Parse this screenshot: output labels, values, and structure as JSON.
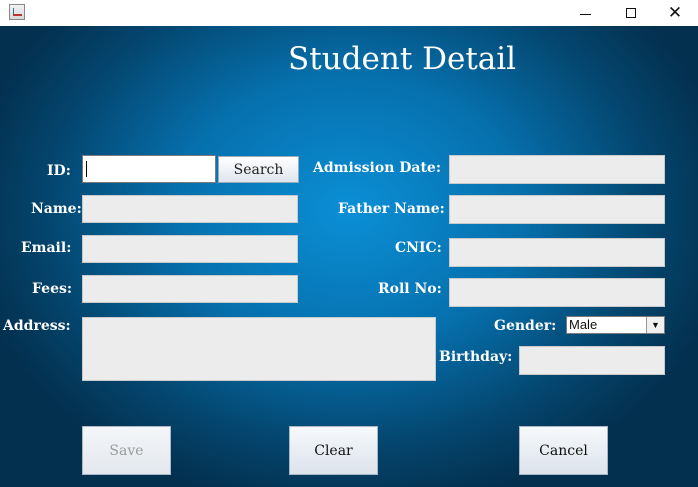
{
  "window": {
    "minimize_icon": "minimize-icon",
    "maximize_icon": "maximize-icon",
    "close_glyph": "✕"
  },
  "form": {
    "title": "Student Detail",
    "labels": {
      "id": "ID:",
      "name": "Name:",
      "email": "Email:",
      "fees": "Fees:",
      "address": "Address:",
      "admission_date": "Admission Date:",
      "father_name": "Father Name:",
      "cnic": "CNIC:",
      "roll_no": "Roll No:",
      "gender": "Gender:",
      "birthday": "Birthday:"
    },
    "values": {
      "id": "",
      "name": "",
      "email": "",
      "fees": "",
      "address": "",
      "admission_date": "",
      "father_name": "",
      "cnic": "",
      "roll_no": "",
      "birthday": ""
    },
    "gender_selected": "Male",
    "search_label": "Search"
  },
  "buttons": {
    "save": "Save",
    "clear": "Clear",
    "cancel": "Cancel"
  },
  "colors": {
    "background_center": "#0b8fd6",
    "background_edge": "#03304f",
    "label_text": "#ffffff",
    "field_bg": "#ececec"
  }
}
